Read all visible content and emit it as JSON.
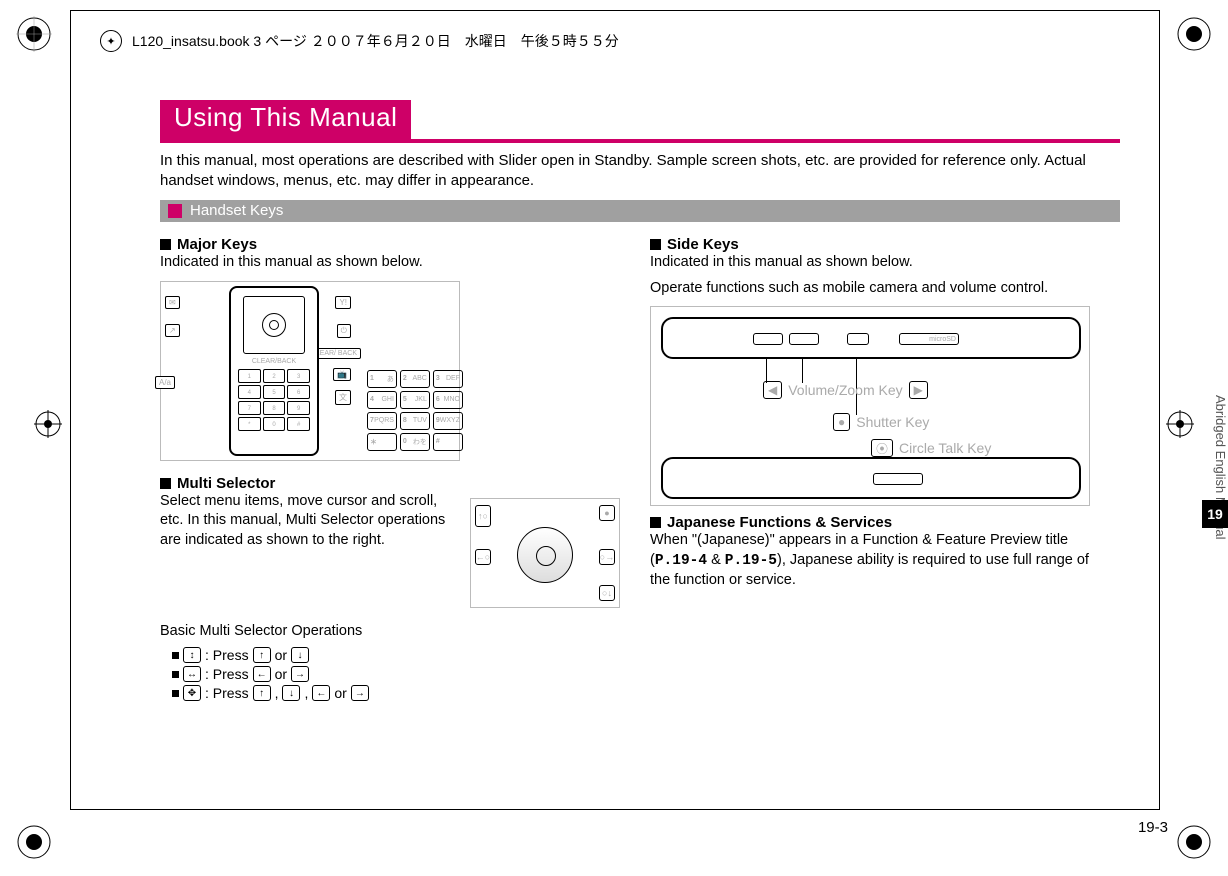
{
  "print_header": "L120_insatsu.book  3 ページ  ２００７年６月２０日　水曜日　午後５時５５分",
  "title": "Using This Manual",
  "intro": "In this manual, most operations are described with Slider open in Standby. Sample screen shots, etc. are provided for reference only. Actual handset windows, menus, etc. may differ in appearance.",
  "section_handset": "Handset Keys",
  "left": {
    "major_head": "Major Keys",
    "major_text": "Indicated in this manual as shown below.",
    "multi_head": "Multi Selector",
    "multi_text": "Select menu items, move cursor and scroll, etc. In this manual, Multi Selector operations are indicated as shown to the right.",
    "basic_head": "Basic Multi Selector Operations",
    "op1_a": ": Press",
    "op1_b": "or",
    "op2_a": ": Press",
    "op2_b": "or",
    "op3_a": ": Press",
    "op3_b": ",",
    "op3_c": ",",
    "op3_d": "or",
    "phone_label": "CLEAR/BACK",
    "callouts": {
      "aa": "A/a",
      "clear": "CLEAR/\nBACK",
      "y": "Y!"
    },
    "keys": [
      "1",
      "2",
      "3",
      "4",
      "5",
      "6",
      "7",
      "8",
      "9",
      "*",
      "0",
      "#"
    ],
    "keylabels": [
      "あ",
      "ABC",
      "DEF",
      "GHI",
      "JKL",
      "MNO",
      "PQRS",
      "TUV",
      "WXYZ",
      "",
      "わを",
      ""
    ]
  },
  "right": {
    "side_head": "Side Keys",
    "side_text1": "Indicated in this manual as shown below.",
    "side_text2": "Operate functions such as mobile camera and volume control.",
    "vol_label": "Volume/Zoom Key",
    "shutter_label": "Shutter Key",
    "circle_label": "Circle Talk Key",
    "microsd": "microSD",
    "jp_head": "Japanese Functions & Services",
    "jp_text_a": "When \"(Japanese)\" appears in a Function & Feature Preview title (",
    "jp_ref1": "P.19-4",
    "jp_amp": " & ",
    "jp_ref2": "P.19-5",
    "jp_text_b": "), Japanese ability is required to use full range of the function or service."
  },
  "side_tab": "Abridged English Manual",
  "chapter": "19",
  "page": "19-3"
}
